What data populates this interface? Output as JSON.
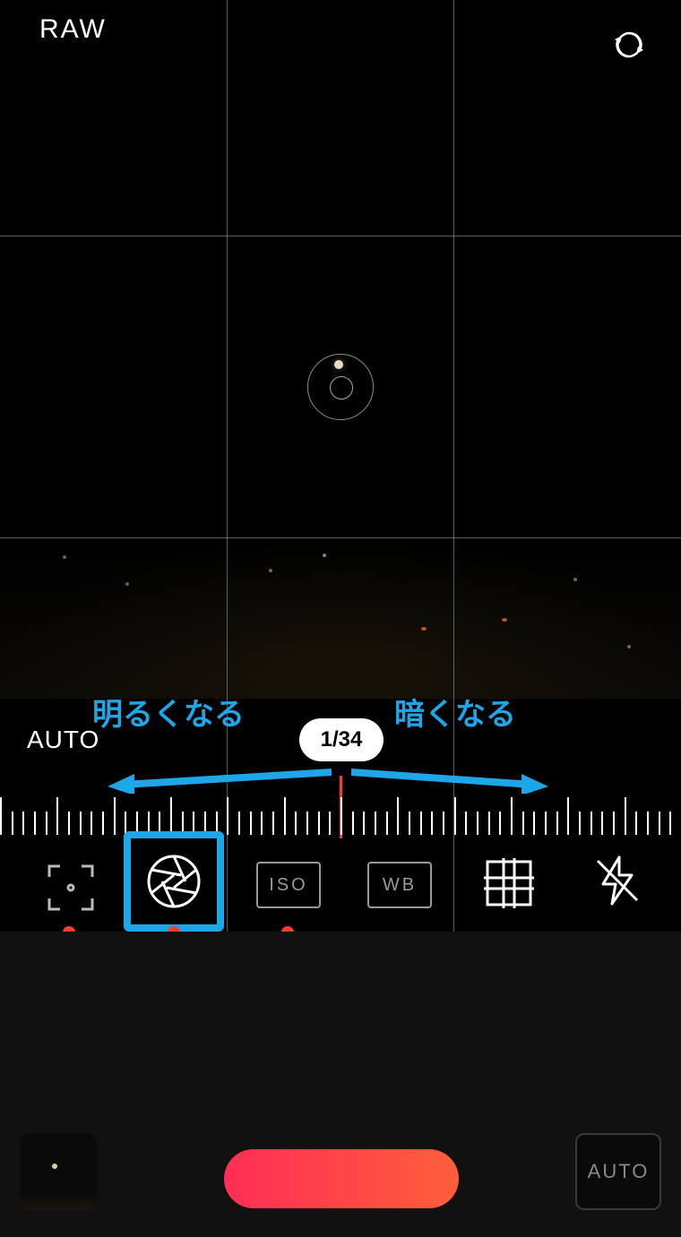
{
  "top": {
    "format_badge": "RAW"
  },
  "annotations": {
    "brighter": "明るくなる",
    "darker": "暗くなる"
  },
  "exposure": {
    "auto_label": "AUTO",
    "shutter_value": "1/34"
  },
  "tools": {
    "focus": "focus",
    "shutter": "shutter-speed",
    "iso_label": "ISO",
    "wb_label": "WB",
    "grid": "grid",
    "flash": "flash-off"
  },
  "dock": {
    "auto_mode_label": "AUTO"
  },
  "colors": {
    "accent": "#ff3b30",
    "highlight": "#1ea7e8",
    "shutter_gradient_from": "#ff2d55",
    "shutter_gradient_to": "#ff5e3a"
  }
}
